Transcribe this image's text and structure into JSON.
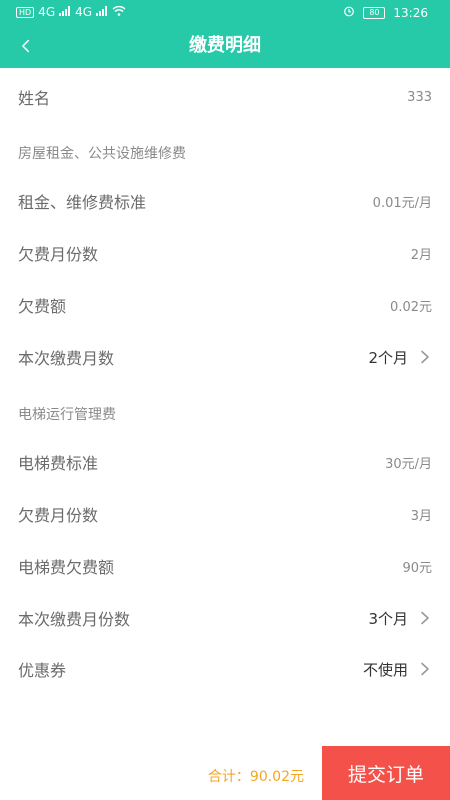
{
  "status_bar": {
    "hd": "HD",
    "net1": "4G",
    "net2": "4G",
    "battery": "80",
    "time": "13:26"
  },
  "header": {
    "title": "缴费明细"
  },
  "rows": {
    "name": {
      "label": "姓名",
      "value": "333"
    },
    "section1": {
      "title": "房屋租金、公共设施维修费"
    },
    "rent_std": {
      "label": "租金、维修费标准",
      "value": "0.01元/月"
    },
    "owed_months": {
      "label": "欠费月份数",
      "value": "2月"
    },
    "owed_amount": {
      "label": "欠费额",
      "value": "0.02元"
    },
    "pay_months": {
      "label": "本次缴费月数",
      "value": "2个月"
    },
    "section2": {
      "title": "电梯运行管理费"
    },
    "elevator_std": {
      "label": "电梯费标准",
      "value": "30元/月"
    },
    "elevator_owed_months": {
      "label": "欠费月份数",
      "value": "3月"
    },
    "elevator_owed_amount": {
      "label": "电梯费欠费额",
      "value": "90元"
    },
    "elevator_pay_months": {
      "label": "本次缴费月份数",
      "value": "3个月"
    },
    "coupon": {
      "label": "优惠券",
      "value": "不使用"
    }
  },
  "footer": {
    "total": "合计：90.02元",
    "submit": "提交订单"
  },
  "icons": {
    "back": "chevron-left-icon",
    "chevron": "chevron-right-icon"
  },
  "colors": {
    "header": "#26c9a8",
    "submit": "#f4514a",
    "total": "#f5a623"
  }
}
